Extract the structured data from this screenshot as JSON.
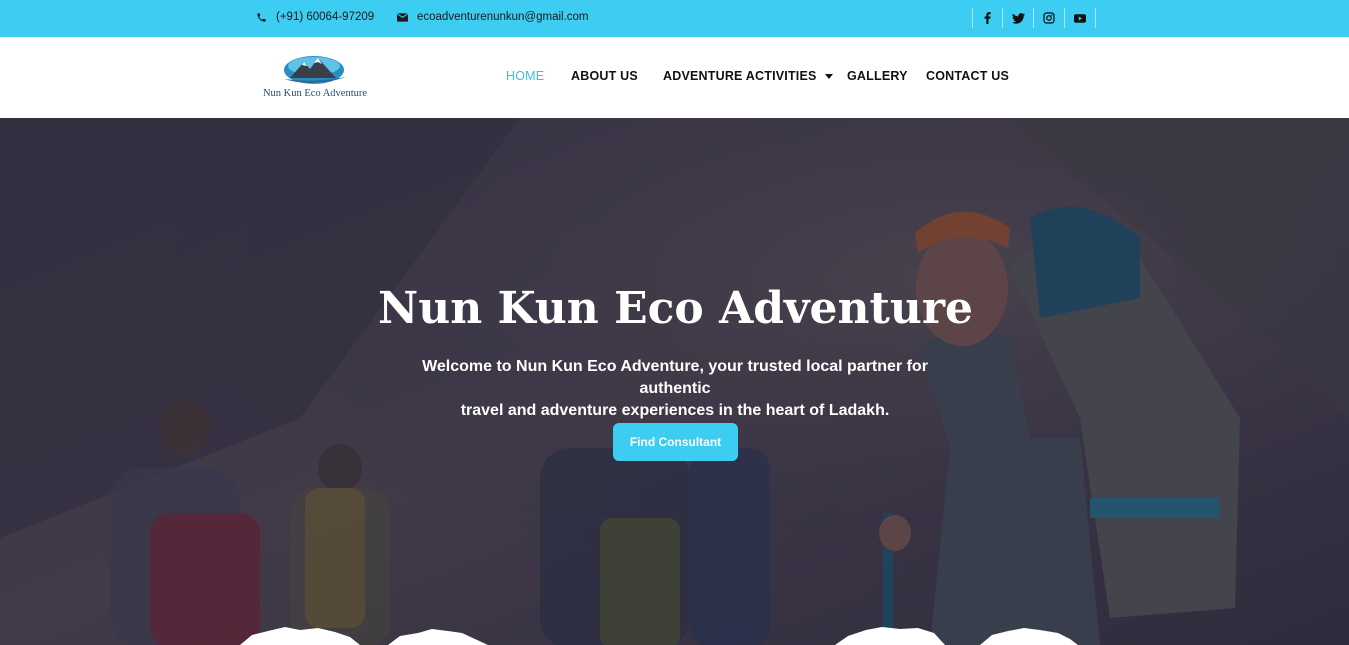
{
  "topbar": {
    "phone": "(+91) 60064-97209",
    "email": "ecoadventurenunkun@gmail.com",
    "socials": [
      "facebook-icon",
      "twitter-icon",
      "instagram-icon",
      "youtube-icon"
    ]
  },
  "header": {
    "logo_text": "Nun Kun Eco Adventure",
    "nav": [
      {
        "label": "HOME",
        "active": true
      },
      {
        "label": "ABOUT US"
      },
      {
        "label": "ADVENTURE ACTIVITIES",
        "has_dropdown": true
      },
      {
        "label": "GALLERY"
      },
      {
        "label": "CONTACT US"
      }
    ]
  },
  "hero": {
    "title": "Nun Kun Eco Adventure",
    "subtitle_line1": "Welcome to Nun Kun Eco Adventure, your trusted local partner for authentic",
    "subtitle_line2": "travel and adventure experiences in the heart of Ladakh.",
    "button_label": "Find Consultant"
  },
  "colors": {
    "accent": "#3dcdf2",
    "nav_active": "#3dbce6",
    "text_dark": "#111111"
  }
}
